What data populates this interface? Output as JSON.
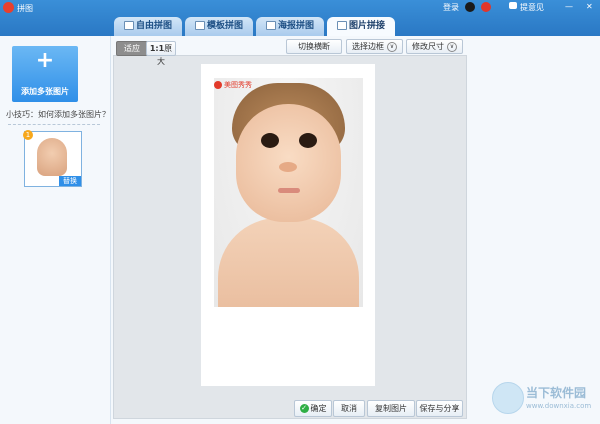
{
  "app": {
    "title": "拼图"
  },
  "header": {
    "login": "登录",
    "feedback": "提意见",
    "minimize": "—",
    "close": "✕"
  },
  "tabs": [
    {
      "label": "自由拼图",
      "active": false
    },
    {
      "label": "模板拼图",
      "active": false
    },
    {
      "label": "海报拼图",
      "active": false
    },
    {
      "label": "图片拼接",
      "active": true
    }
  ],
  "sidebar": {
    "add_label": "添加多张图片",
    "add_symbol": "+",
    "tip": "小技巧：如何添加多张图片？",
    "thumb_number": "1",
    "replace_label": "替换"
  },
  "toolbar": {
    "fit_label": "适应",
    "actual_prefix": "1:1",
    "actual_label": "原大",
    "switch_layout": "切换横断",
    "select_border": "选择边框",
    "resize": "修改尺寸"
  },
  "canvas": {
    "watermark": "美图秀秀"
  },
  "bottom": {
    "confirm": "确定",
    "cancel": "取消",
    "copy": "复制图片",
    "save": "保存与分享"
  },
  "branding": {
    "name": "当下软件园",
    "url": "www.downxia.com"
  },
  "colors": {
    "accent": "#2f8fe8",
    "titlebar": "#3a8fd8",
    "confirm": "#2fae45"
  }
}
